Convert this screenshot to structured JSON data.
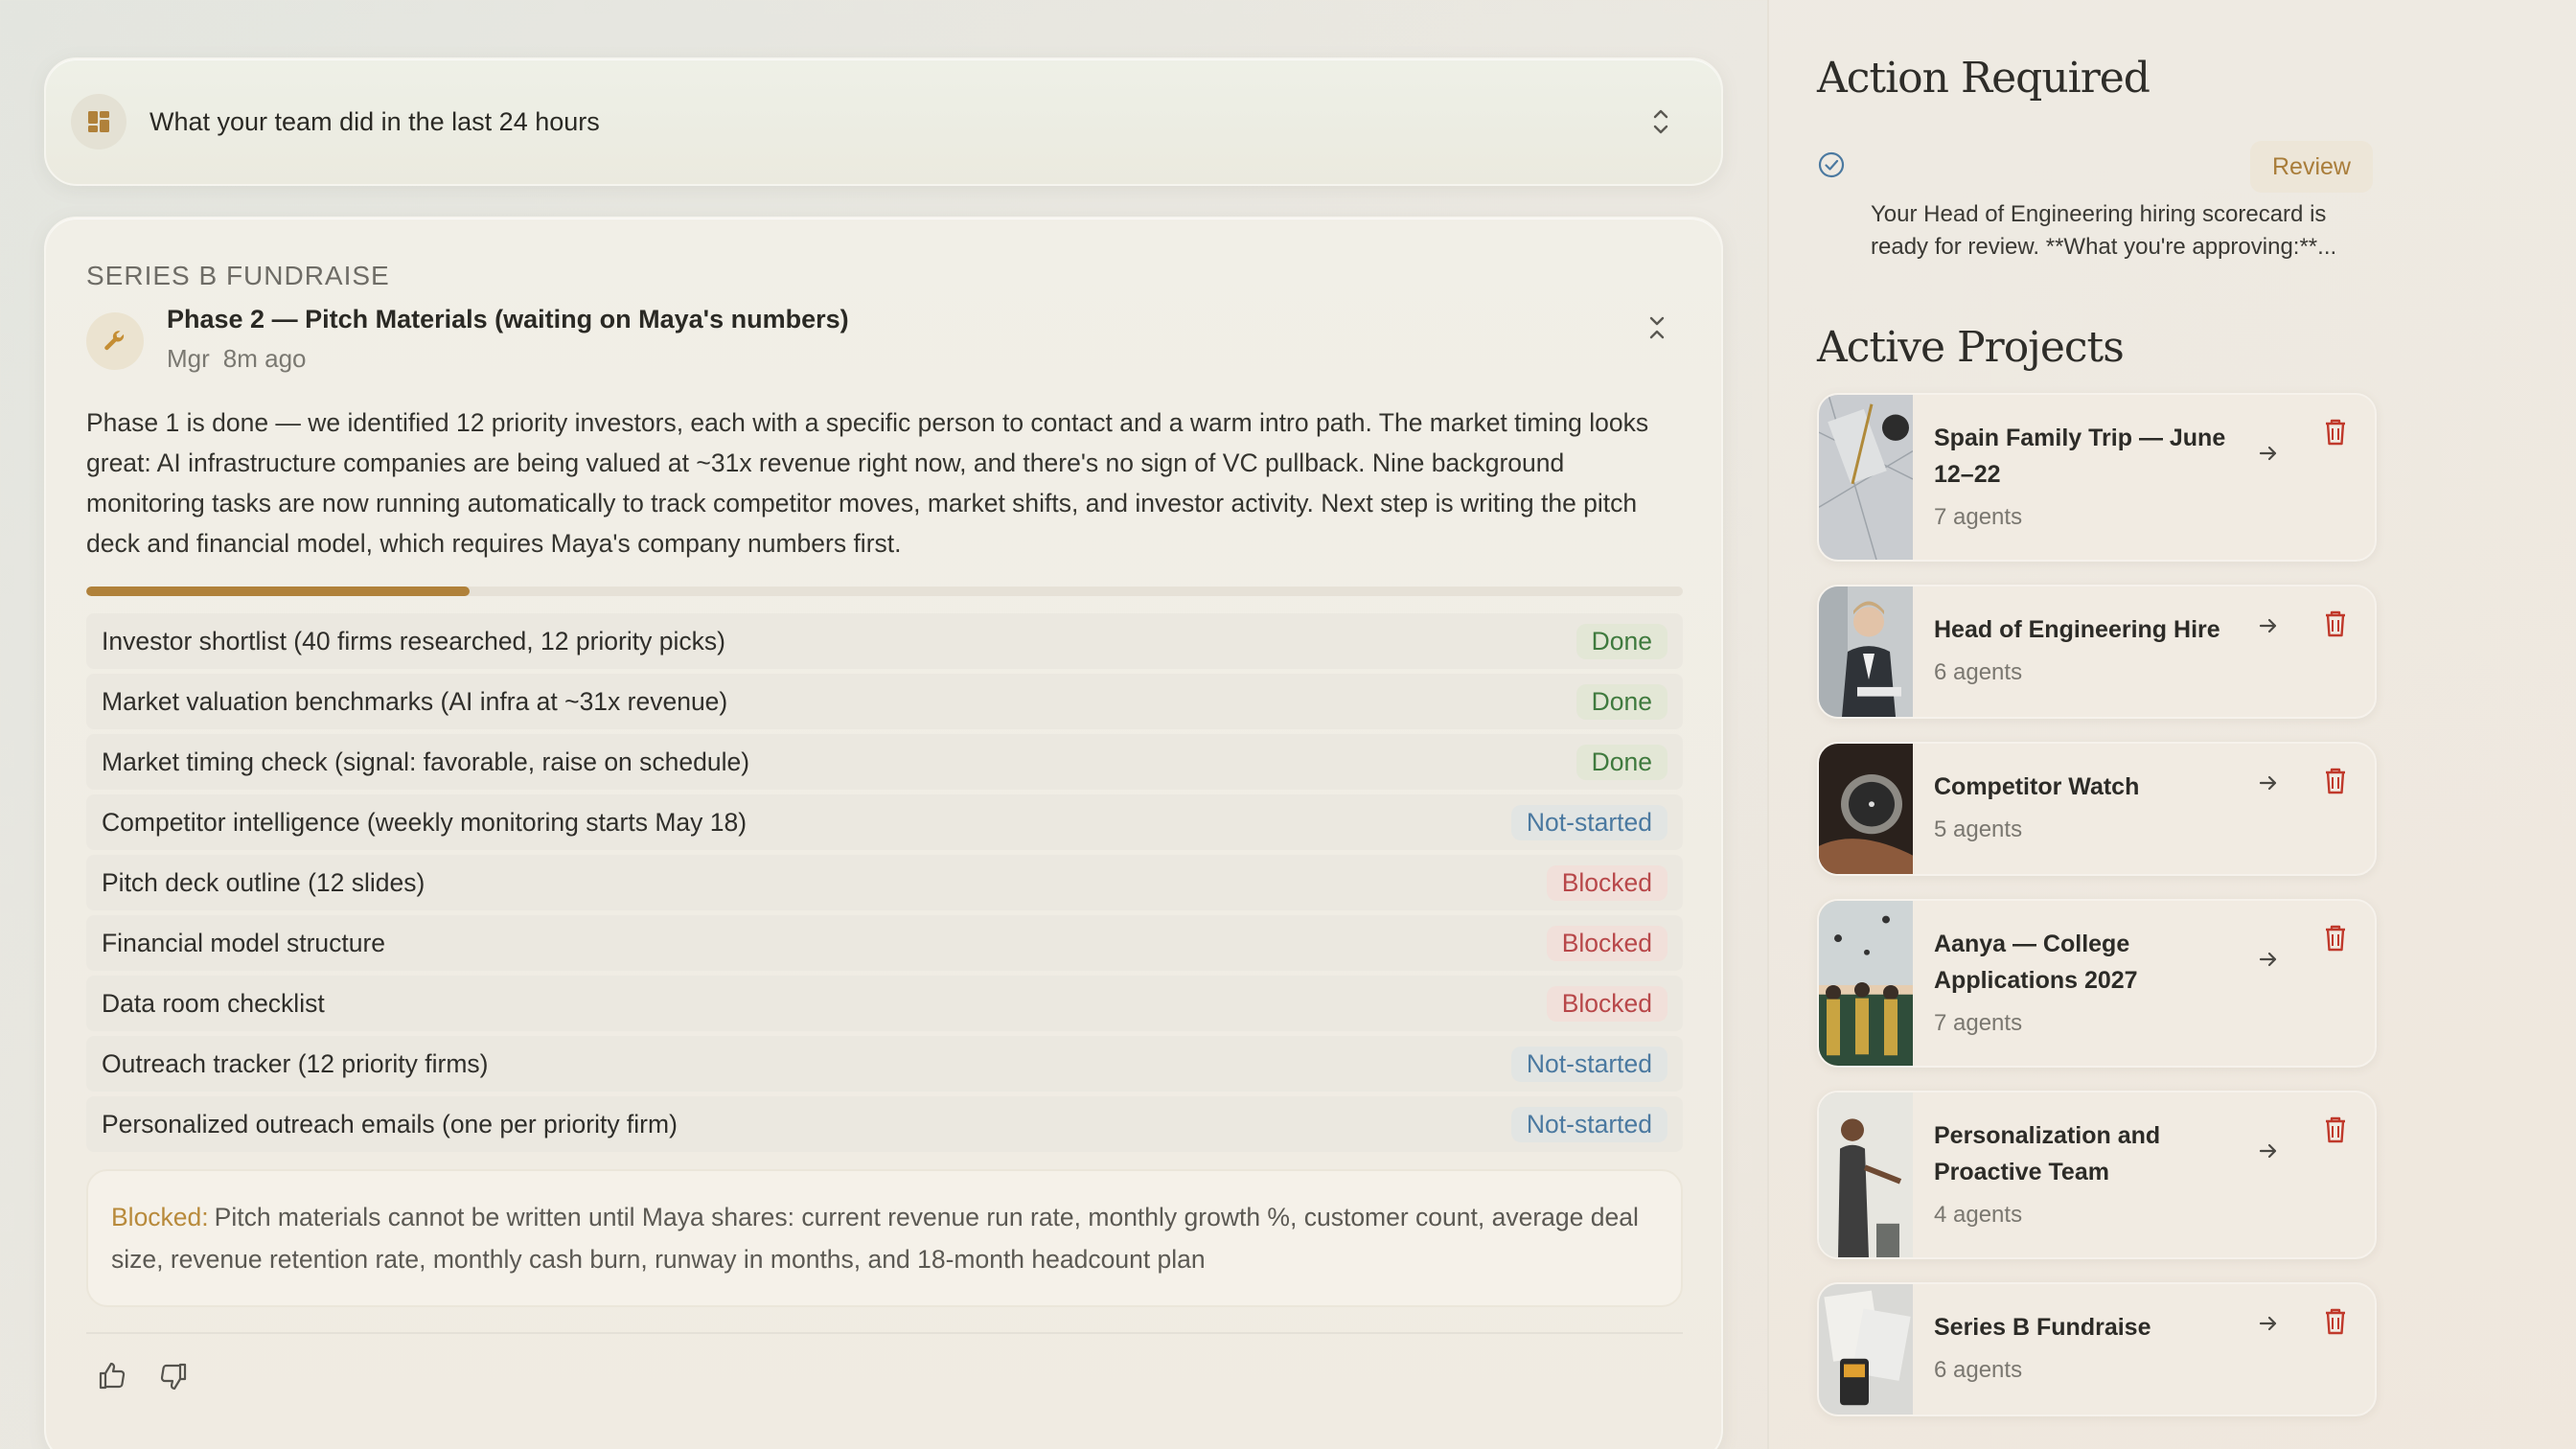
{
  "summary": {
    "title": "What your team did in the last 24 hours",
    "icon": "dashboard-icon"
  },
  "project_card": {
    "section_label": "SERIES B FUNDRAISE",
    "phase_title": "Phase 2 — Pitch Materials (waiting on Maya's numbers)",
    "author": "Mgr",
    "time_ago": "8m ago",
    "description": "Phase 1 is done — we identified 12 priority investors, each with a specific person to contact and a warm intro path. The market timing looks great: AI infrastructure companies are being valued at ~31x revenue right now, and there's no sign of VC pullback. Nine background monitoring tasks are now running automatically to track competitor moves, market shifts, and investor activity. Next step is writing the pitch deck and financial model, which requires Maya's company numbers first.",
    "progress_fraction": 0.24,
    "tasks": [
      {
        "name": "Investor shortlist (40 firms researched, 12 priority picks)",
        "status": "Done"
      },
      {
        "name": "Market valuation benchmarks (AI infra at ~31x revenue)",
        "status": "Done"
      },
      {
        "name": "Market timing check (signal: favorable, raise on schedule)",
        "status": "Done"
      },
      {
        "name": "Competitor intelligence (weekly monitoring starts May 18)",
        "status": "Not-started"
      },
      {
        "name": "Pitch deck outline (12 slides)",
        "status": "Blocked"
      },
      {
        "name": "Financial model structure",
        "status": "Blocked"
      },
      {
        "name": "Data room checklist",
        "status": "Blocked"
      },
      {
        "name": "Outreach tracker (12 priority firms)",
        "status": "Not-started"
      },
      {
        "name": "Personalized outreach emails (one per priority firm)",
        "status": "Not-started"
      }
    ],
    "blocked_label": "Blocked:",
    "blocked_text": "Pitch materials cannot be written until Maya shares: current revenue run rate, monthly growth %, customer count, average deal size, revenue retention rate, monthly cash burn, runway in months, and 18-month headcount plan"
  },
  "action_required": {
    "title": "Action Required",
    "review_label": "Review",
    "text": "Your Head of Engineering hiring scorecard is ready for review. **What you're approving:**..."
  },
  "active_projects": {
    "title": "Active Projects",
    "items": [
      {
        "name": "Spain Family Trip — June 12–22",
        "agents": "7 agents"
      },
      {
        "name": "Head of Engineering Hire",
        "agents": "6 agents"
      },
      {
        "name": "Competitor Watch",
        "agents": "5 agents"
      },
      {
        "name": "Aanya — College Applications 2027",
        "agents": "7 agents"
      },
      {
        "name": "Personalization and Proactive Team",
        "agents": "4 agents"
      },
      {
        "name": "Series B Fundraise",
        "agents": "6 agents"
      }
    ]
  },
  "colors": {
    "accent": "#b0813a",
    "done": "#3f7a3e",
    "not_started": "#4b79a0",
    "blocked": "#b8484a"
  }
}
